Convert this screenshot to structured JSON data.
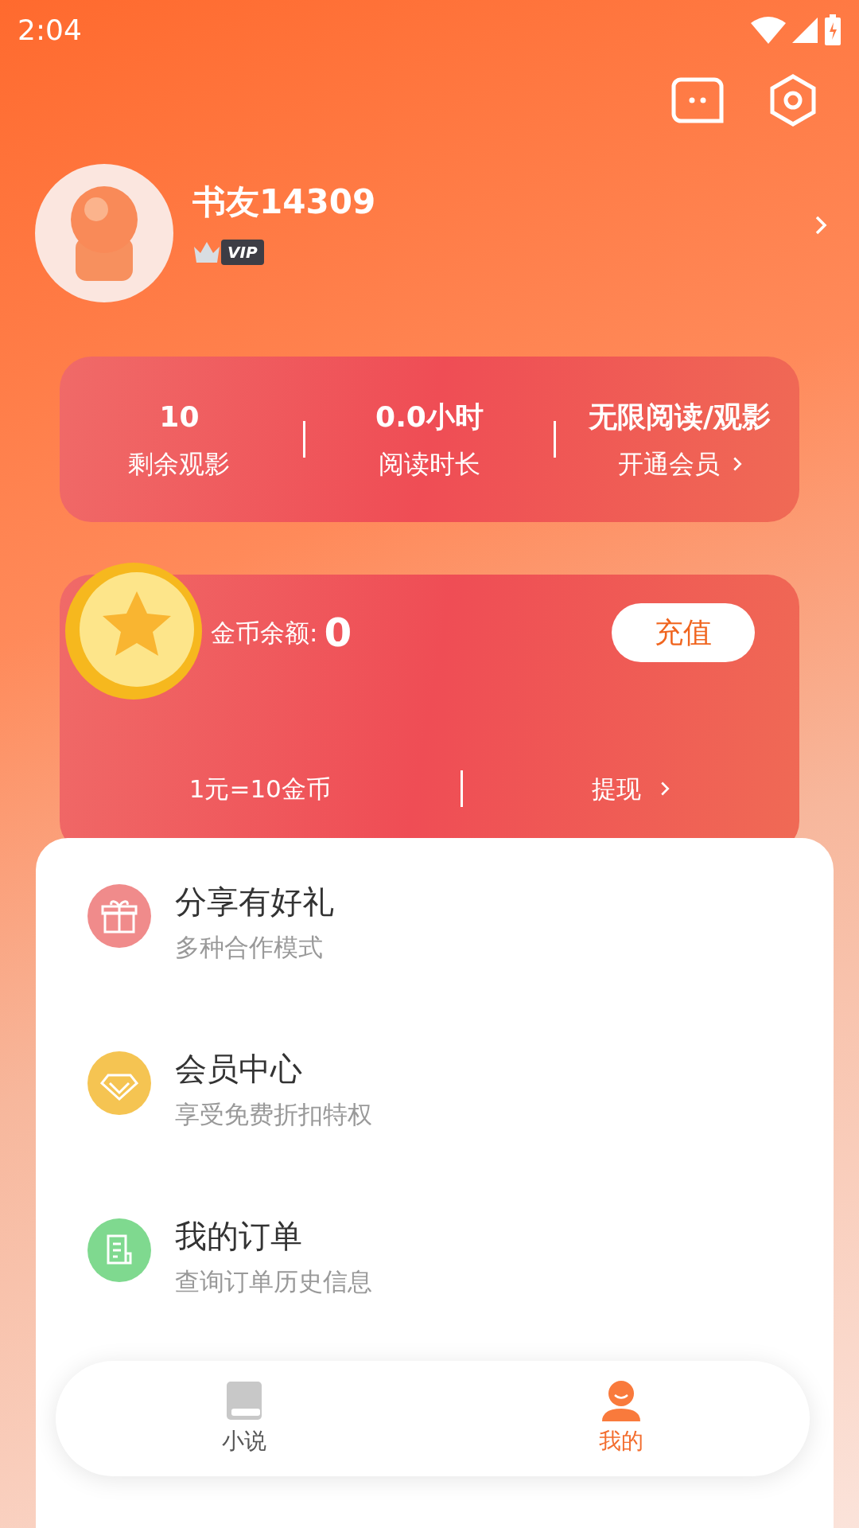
{
  "status_bar": {
    "time": "2:04"
  },
  "profile": {
    "name": "书友14309",
    "badge": "VIP"
  },
  "stats": [
    {
      "value": "10",
      "label": "剩余观影",
      "link": false
    },
    {
      "value": "0.0小时",
      "label": "阅读时长",
      "link": false
    },
    {
      "value": "无限阅读/观影",
      "label": "开通会员",
      "link": true
    }
  ],
  "wallet": {
    "balance_label": "金币余额:",
    "balance": "0",
    "recharge_button": "充值",
    "rate": "1元=10金币",
    "withdraw": "提现"
  },
  "menu": [
    {
      "title": "分享有好礼",
      "subtitle": "多种合作模式",
      "kind": "gift",
      "color": "#f08b8b"
    },
    {
      "title": "会员中心",
      "subtitle": "享受免费折扣特权",
      "kind": "diamond",
      "color": "#f5c452"
    },
    {
      "title": "我的订单",
      "subtitle": "查询订单历史信息",
      "kind": "order",
      "color": "#7fd98f"
    }
  ],
  "tabs": [
    {
      "label": "小说",
      "kind": "book",
      "selected": false
    },
    {
      "label": "我的",
      "kind": "person",
      "selected": true
    }
  ]
}
